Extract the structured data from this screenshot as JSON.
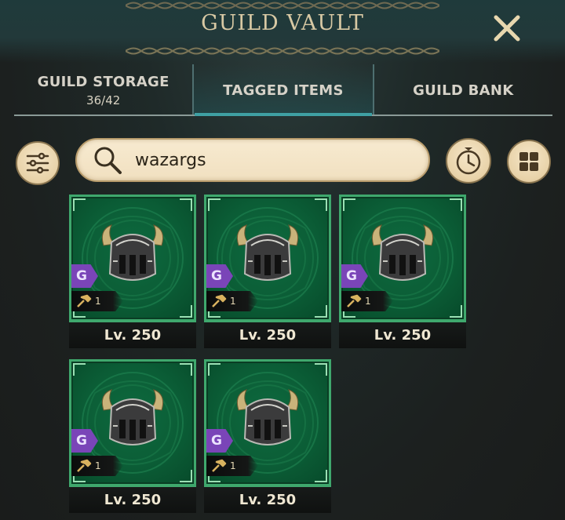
{
  "header": {
    "title": "GUILD VAULT"
  },
  "tabs": [
    {
      "label": "GUILD STORAGE",
      "count": "36/42"
    },
    {
      "label": "TAGGED ITEMS",
      "count": ""
    },
    {
      "label": "GUILD BANK",
      "count": ""
    }
  ],
  "active_tab": "TAGGED ITEMS",
  "search": {
    "value": "wazargs"
  },
  "toolbar": {
    "filter_icon": "sliders-icon",
    "timer_icon": "stopwatch-icon",
    "grid_icon": "grid-view-icon",
    "close_icon": "close-icon"
  },
  "items": [
    {
      "level": "Lv. 250",
      "grade": "G",
      "tag_count": "1"
    },
    {
      "level": "Lv. 250",
      "grade": "G",
      "tag_count": "1"
    },
    {
      "level": "Lv. 250",
      "grade": "G",
      "tag_count": "1"
    },
    {
      "level": "Lv. 250",
      "grade": "G",
      "tag_count": "1"
    },
    {
      "level": "Lv. 250",
      "grade": "G",
      "tag_count": "1"
    }
  ],
  "colors": {
    "card_green": "#0b5d36",
    "card_border": "#3fa86d",
    "grade_purple": "#7a45b8",
    "active_tab_accent": "#3fa0a3"
  }
}
